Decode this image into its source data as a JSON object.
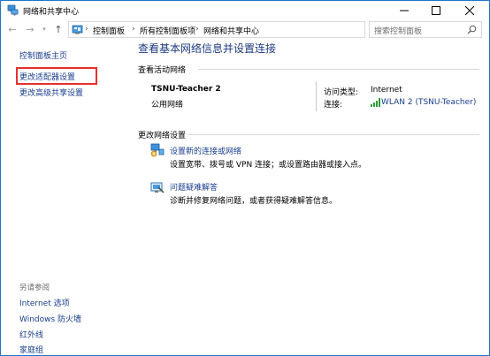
{
  "window": {
    "title": "网络和共享中心",
    "controls": {
      "minimize": "—",
      "maximize": "☐",
      "close": "✕"
    }
  },
  "nav": {
    "back": "←",
    "forward": "→",
    "recent": "▾",
    "up": "↑",
    "breadcrumb": [
      "控制面板",
      "所有控制面板项",
      "网络和共享中心"
    ],
    "separator": "›",
    "dropdown": "▾",
    "refresh": "↻",
    "search_placeholder": "搜索控制面板"
  },
  "sidebar": {
    "home_link": "控制面板主页",
    "items": [
      {
        "label": "更改适配器设置",
        "highlighted": true
      },
      {
        "label": "更改高级共享设置",
        "highlighted": false
      }
    ],
    "see_also_title": "另请参阅",
    "see_also": [
      "Internet 选项",
      "Windows 防火墙",
      "红外线",
      "家庭组"
    ]
  },
  "main": {
    "title": "查看基本网络信息并设置连接",
    "active_networks": {
      "heading": "查看活动网络",
      "network_name": "TSNU-Teacher  2",
      "network_type": "公用网络",
      "access_type_label": "访问类型:",
      "access_type_value": "Internet",
      "connection_label": "连接:",
      "connection_value": "WLAN 2 (TSNU-Teacher)"
    },
    "change_settings": {
      "heading": "更改网络设置",
      "tasks": [
        {
          "link": "设置新的连接或网络",
          "desc": "设置宽带、拨号或 VPN 连接；或设置路由器或接入点。",
          "icon": "new-connection-icon"
        },
        {
          "link": "问题疑难解答",
          "desc": "诊断并修复网络问题，或者获得疑难解答信息。",
          "icon": "troubleshoot-icon"
        }
      ]
    }
  },
  "colors": {
    "border": "#1979ca",
    "link": "#1a3e8e",
    "title": "#1e3a80",
    "highlight": "#e5312a"
  }
}
